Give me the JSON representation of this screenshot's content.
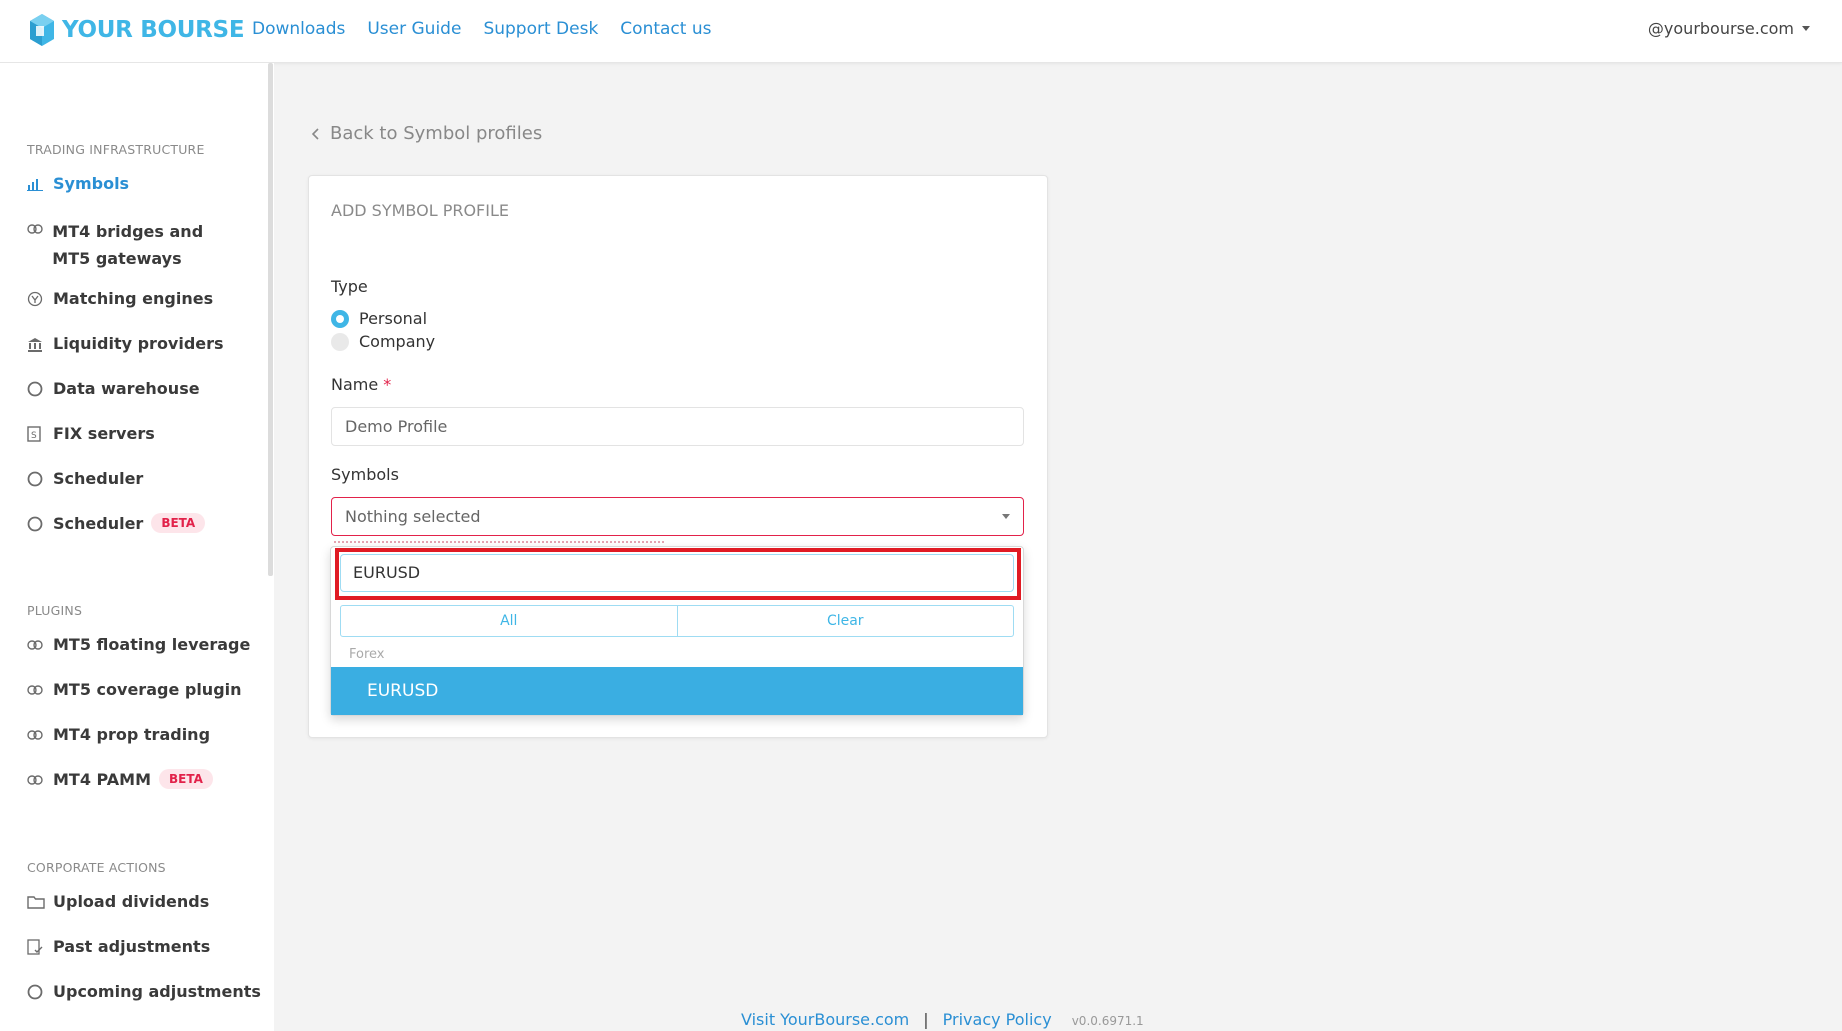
{
  "header": {
    "brand": "YOUR BOURSE",
    "nav": [
      "Downloads",
      "User Guide",
      "Support Desk",
      "Contact us"
    ],
    "user_email": "@yourbourse.com"
  },
  "sidebar": {
    "sections": [
      {
        "title": "TRADING INFRASTRUCTURE",
        "items": [
          {
            "label": "Symbols",
            "icon": "bar-chart-icon",
            "active": true
          },
          {
            "label": "MT4 bridges and MT5 gateways",
            "icon": "bridge-icon"
          },
          {
            "label": "Matching engines",
            "icon": "engine-icon"
          },
          {
            "label": "Liquidity providers",
            "icon": "bank-icon"
          },
          {
            "label": "Data warehouse",
            "icon": "circle-icon"
          },
          {
            "label": "FIX servers",
            "icon": "server-icon"
          },
          {
            "label": "Scheduler",
            "icon": "circle-icon"
          },
          {
            "label": "Scheduler",
            "icon": "circle-icon",
            "badge": "BETA"
          }
        ]
      },
      {
        "title": "PLUGINS",
        "items": [
          {
            "label": "MT5 floating leverage",
            "icon": "plugin-icon"
          },
          {
            "label": "MT5 coverage plugin",
            "icon": "plugin-icon"
          },
          {
            "label": "MT4 prop trading",
            "icon": "plugin-icon"
          },
          {
            "label": "MT4 PAMM",
            "icon": "plugin-icon",
            "badge": "BETA"
          }
        ]
      },
      {
        "title": "CORPORATE ACTIONS",
        "items": [
          {
            "label": "Upload dividends",
            "icon": "folder-icon"
          },
          {
            "label": "Past adjustments",
            "icon": "checklist-icon"
          },
          {
            "label": "Upcoming adjustments",
            "icon": "circle-icon"
          }
        ]
      }
    ]
  },
  "main": {
    "back_link": "Back to Symbol profiles",
    "card_title": "ADD SYMBOL PROFILE",
    "type_label": "Type",
    "type_options": [
      "Personal",
      "Company"
    ],
    "type_selected": "Personal",
    "name_label": "Name",
    "required_mark": "*",
    "name_value": "Demo Profile",
    "symbols_label": "Symbols",
    "symbols_select": "Nothing selected",
    "dropdown": {
      "search_value": "EURUSD",
      "all_button": "All",
      "clear_button": "Clear",
      "group": "Forex",
      "option": "EURUSD"
    }
  },
  "footer": {
    "visit": "Visit YourBourse.com",
    "separator": "|",
    "privacy": "Privacy Policy",
    "version": "v0.0.6971.1"
  },
  "colors": {
    "accent": "#3fb6e6",
    "link": "#2a8fd4",
    "danger": "#e2224a",
    "highlight_box": "#e01b24",
    "option_selected": "#3aaee2"
  }
}
